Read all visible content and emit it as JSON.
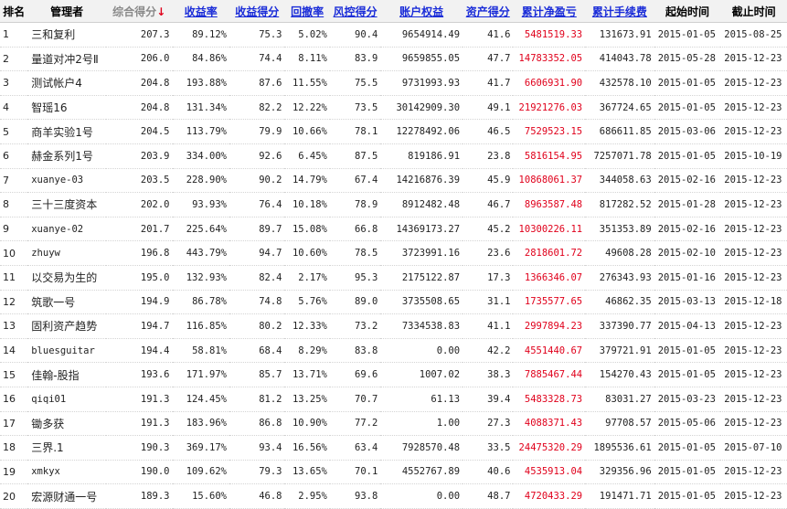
{
  "headers": {
    "rank": "排名",
    "manager": "管理者",
    "composite": "综合得分",
    "composite_arrow": "↓",
    "return_rate": "收益率",
    "return_score": "收益得分",
    "drawdown": "回撤率",
    "risk_score": "风控得分",
    "equity": "账户权益",
    "asset_score": "资产得分",
    "cum_profit": "累计净盈亏",
    "cum_fee": "累计手续费",
    "start": "起始时间",
    "end": "截止时间"
  },
  "colors": {
    "link": "#1a2cd8",
    "profit": "#e0001b",
    "header_bg": "#f2f2f2"
  },
  "rows": [
    {
      "rank": "1",
      "manager": "三和复利",
      "composite": "207.3",
      "return_rate": "89.12%",
      "return_score": "75.3",
      "drawdown": "5.02%",
      "risk_score": "90.4",
      "equity": "9654914.49",
      "asset_score": "41.6",
      "cum_profit": "5481519.33",
      "cum_fee": "131673.91",
      "start": "2015-01-05",
      "end": "2015-08-25"
    },
    {
      "rank": "2",
      "manager": "量道对冲2号Ⅱ",
      "composite": "206.0",
      "return_rate": "84.86%",
      "return_score": "74.4",
      "drawdown": "8.11%",
      "risk_score": "83.9",
      "equity": "9659855.05",
      "asset_score": "47.7",
      "cum_profit": "14783352.05",
      "cum_fee": "414043.78",
      "start": "2015-05-28",
      "end": "2015-12-23"
    },
    {
      "rank": "3",
      "manager": "测试帐户4",
      "composite": "204.8",
      "return_rate": "193.88%",
      "return_score": "87.6",
      "drawdown": "11.55%",
      "risk_score": "75.5",
      "equity": "9731993.93",
      "asset_score": "41.7",
      "cum_profit": "6606931.90",
      "cum_fee": "432578.10",
      "start": "2015-01-05",
      "end": "2015-12-23"
    },
    {
      "rank": "4",
      "manager": "智瑶16",
      "composite": "204.8",
      "return_rate": "131.34%",
      "return_score": "82.2",
      "drawdown": "12.22%",
      "risk_score": "73.5",
      "equity": "30142909.30",
      "asset_score": "49.1",
      "cum_profit": "21921276.03",
      "cum_fee": "367724.65",
      "start": "2015-01-05",
      "end": "2015-12-23"
    },
    {
      "rank": "5",
      "manager": "商羊实验1号",
      "composite": "204.5",
      "return_rate": "113.79%",
      "return_score": "79.9",
      "drawdown": "10.66%",
      "risk_score": "78.1",
      "equity": "12278492.06",
      "asset_score": "46.5",
      "cum_profit": "7529523.15",
      "cum_fee": "686611.85",
      "start": "2015-03-06",
      "end": "2015-12-23"
    },
    {
      "rank": "6",
      "manager": "赫金系列1号",
      "composite": "203.9",
      "return_rate": "334.00%",
      "return_score": "92.6",
      "drawdown": "6.45%",
      "risk_score": "87.5",
      "equity": "819186.91",
      "asset_score": "23.8",
      "cum_profit": "5816154.95",
      "cum_fee": "7257071.78",
      "start": "2015-01-05",
      "end": "2015-10-19"
    },
    {
      "rank": "7",
      "manager": "xuanye-03",
      "composite": "203.5",
      "return_rate": "228.90%",
      "return_score": "90.2",
      "drawdown": "14.79%",
      "risk_score": "67.4",
      "equity": "14216876.39",
      "asset_score": "45.9",
      "cum_profit": "10868061.37",
      "cum_fee": "344058.63",
      "start": "2015-02-16",
      "end": "2015-12-23"
    },
    {
      "rank": "8",
      "manager": "三十三度资本",
      "composite": "202.0",
      "return_rate": "93.93%",
      "return_score": "76.4",
      "drawdown": "10.18%",
      "risk_score": "78.9",
      "equity": "8912482.48",
      "asset_score": "46.7",
      "cum_profit": "8963587.48",
      "cum_fee": "817282.52",
      "start": "2015-01-28",
      "end": "2015-12-23"
    },
    {
      "rank": "9",
      "manager": "xuanye-02",
      "composite": "201.7",
      "return_rate": "225.64%",
      "return_score": "89.7",
      "drawdown": "15.08%",
      "risk_score": "66.8",
      "equity": "14369173.27",
      "asset_score": "45.2",
      "cum_profit": "10300226.11",
      "cum_fee": "351353.89",
      "start": "2015-02-16",
      "end": "2015-12-23"
    },
    {
      "rank": "10",
      "manager": "zhuyw",
      "composite": "196.8",
      "return_rate": "443.79%",
      "return_score": "94.7",
      "drawdown": "10.60%",
      "risk_score": "78.5",
      "equity": "3723991.16",
      "asset_score": "23.6",
      "cum_profit": "2818601.72",
      "cum_fee": "49608.28",
      "start": "2015-02-10",
      "end": "2015-12-23"
    },
    {
      "rank": "11",
      "manager": "以交易为生的",
      "composite": "195.0",
      "return_rate": "132.93%",
      "return_score": "82.4",
      "drawdown": "2.17%",
      "risk_score": "95.3",
      "equity": "2175122.87",
      "asset_score": "17.3",
      "cum_profit": "1366346.07",
      "cum_fee": "276343.93",
      "start": "2015-01-16",
      "end": "2015-12-23"
    },
    {
      "rank": "12",
      "manager": "筑歌一号",
      "composite": "194.9",
      "return_rate": "86.78%",
      "return_score": "74.8",
      "drawdown": "5.76%",
      "risk_score": "89.0",
      "equity": "3735508.65",
      "asset_score": "31.1",
      "cum_profit": "1735577.65",
      "cum_fee": "46862.35",
      "start": "2015-03-13",
      "end": "2015-12-18"
    },
    {
      "rank": "13",
      "manager": "固利资产趋势",
      "composite": "194.7",
      "return_rate": "116.85%",
      "return_score": "80.2",
      "drawdown": "12.33%",
      "risk_score": "73.2",
      "equity": "7334538.83",
      "asset_score": "41.1",
      "cum_profit": "2997894.23",
      "cum_fee": "337390.77",
      "start": "2015-04-13",
      "end": "2015-12-23"
    },
    {
      "rank": "14",
      "manager": "bluesguitar",
      "composite": "194.4",
      "return_rate": "58.81%",
      "return_score": "68.4",
      "drawdown": "8.29%",
      "risk_score": "83.8",
      "equity": "0.00",
      "asset_score": "42.2",
      "cum_profit": "4551440.67",
      "cum_fee": "379721.91",
      "start": "2015-01-05",
      "end": "2015-12-23"
    },
    {
      "rank": "15",
      "manager": "佳翰-股指",
      "composite": "193.6",
      "return_rate": "171.97%",
      "return_score": "85.7",
      "drawdown": "13.71%",
      "risk_score": "69.6",
      "equity": "1007.02",
      "asset_score": "38.3",
      "cum_profit": "7885467.44",
      "cum_fee": "154270.43",
      "start": "2015-01-05",
      "end": "2015-12-23"
    },
    {
      "rank": "16",
      "manager": "qiqi01",
      "composite": "191.3",
      "return_rate": "124.45%",
      "return_score": "81.2",
      "drawdown": "13.25%",
      "risk_score": "70.7",
      "equity": "61.13",
      "asset_score": "39.4",
      "cum_profit": "5483328.73",
      "cum_fee": "83031.27",
      "start": "2015-03-23",
      "end": "2015-12-23"
    },
    {
      "rank": "17",
      "manager": "锄多获",
      "composite": "191.3",
      "return_rate": "183.96%",
      "return_score": "86.8",
      "drawdown": "10.90%",
      "risk_score": "77.2",
      "equity": "1.00",
      "asset_score": "27.3",
      "cum_profit": "4088371.43",
      "cum_fee": "97708.57",
      "start": "2015-05-06",
      "end": "2015-12-23"
    },
    {
      "rank": "18",
      "manager": "三界.1",
      "composite": "190.3",
      "return_rate": "369.17%",
      "return_score": "93.4",
      "drawdown": "16.56%",
      "risk_score": "63.4",
      "equity": "7928570.48",
      "asset_score": "33.5",
      "cum_profit": "24475320.29",
      "cum_fee": "1895536.61",
      "start": "2015-01-05",
      "end": "2015-07-10"
    },
    {
      "rank": "19",
      "manager": "xmkyx",
      "composite": "190.0",
      "return_rate": "109.62%",
      "return_score": "79.3",
      "drawdown": "13.65%",
      "risk_score": "70.1",
      "equity": "4552767.89",
      "asset_score": "40.6",
      "cum_profit": "4535913.04",
      "cum_fee": "329356.96",
      "start": "2015-01-05",
      "end": "2015-12-23"
    },
    {
      "rank": "20",
      "manager": "宏源财通一号",
      "composite": "189.3",
      "return_rate": "15.60%",
      "return_score": "46.8",
      "drawdown": "2.95%",
      "risk_score": "93.8",
      "equity": "0.00",
      "asset_score": "48.7",
      "cum_profit": "4720433.29",
      "cum_fee": "191471.71",
      "start": "2015-01-05",
      "end": "2015-12-23"
    }
  ]
}
